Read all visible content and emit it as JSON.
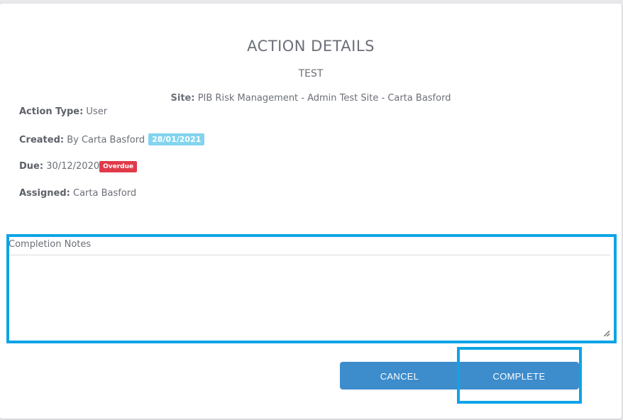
{
  "modal": {
    "title": "ACTION DETAILS",
    "subtitle": "TEST",
    "site": {
      "label": "Site:",
      "value": " PIB Risk Management - Admin Test Site - Carta Basford"
    },
    "fields": {
      "action_type": {
        "label": "Action Type:",
        "value": " User"
      },
      "created": {
        "label": "Created:",
        "value": " By Carta Basford",
        "date_badge": "28/01/2021"
      },
      "due": {
        "label": "Due:",
        "value": " 30/12/2020",
        "status_badge": "Overdue"
      },
      "assigned": {
        "label": "Assigned:",
        "value": " Carta Basford"
      }
    },
    "notes": {
      "label": "Completion Notes",
      "value": ""
    },
    "buttons": {
      "cancel": "CANCEL",
      "complete": "COMPLETE"
    }
  },
  "colors": {
    "button": "#3d8ccc",
    "date_badge": "#82d4ef",
    "overdue_badge": "#e03a4a",
    "highlight": "#0ea4e6"
  }
}
